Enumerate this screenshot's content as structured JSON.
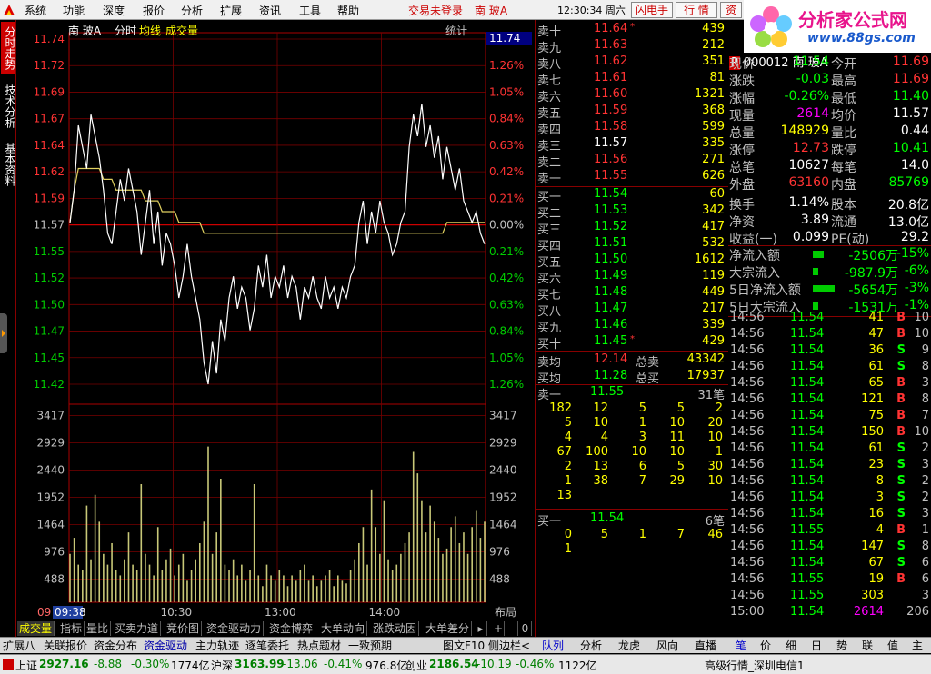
{
  "menubar": {
    "items": [
      "系统",
      "功能",
      "深度",
      "报价",
      "分析",
      "扩展",
      "资讯",
      "工具",
      "帮助"
    ],
    "trade_status": "交易未登录",
    "stock_short": "南  玻A",
    "clock": "12:30:34 周六",
    "btn_flash": "闪电手",
    "btn_quote": "行  情",
    "btn_news": "资"
  },
  "brand": {
    "title": "分析家公式网",
    "url": "www.88gs.com"
  },
  "left_tabs": [
    "分时走势",
    "技术分析",
    "基本资料"
  ],
  "chart_header": {
    "stock": "南  玻A",
    "mode": "分时",
    "avg_label": "均线",
    "vol_label": "成交量",
    "stats_btn": "统计",
    "last_price_badge": "11.74"
  },
  "chart_data": {
    "type": "line",
    "price_axis_left": [
      "11.74",
      "11.72",
      "11.69",
      "11.67",
      "11.64",
      "11.62",
      "11.59",
      "11.57",
      "11.55",
      "11.52",
      "11.50",
      "11.47",
      "11.45",
      "11.42"
    ],
    "pct_axis_right": [
      "",
      "1.26%",
      "1.05%",
      "0.84%",
      "0.63%",
      "0.42%",
      "0.21%",
      "0.00%",
      "0.21%",
      "0.42%",
      "0.63%",
      "0.84%",
      "1.05%",
      "1.26%"
    ],
    "vol_axis_left": [
      "3417",
      "2929",
      "2440",
      "1952",
      "1464",
      "976",
      "488"
    ],
    "vol_axis_right": [
      "3417",
      "2929",
      "2440",
      "1952",
      "1464",
      "976",
      "488"
    ],
    "time_labels": [
      "09:38",
      "10:30",
      "13:00",
      "14:00"
    ],
    "time_start_label": "09",
    "layout_btn": "布局",
    "prev_close": 11.57,
    "ylim": [
      11.42,
      11.74
    ],
    "vol_max": 3417,
    "price": [
      11.57,
      11.6,
      11.66,
      11.64,
      11.62,
      11.67,
      11.65,
      11.63,
      11.6,
      11.56,
      11.55,
      11.58,
      11.61,
      11.59,
      11.62,
      11.6,
      11.58,
      11.54,
      11.57,
      11.6,
      11.55,
      11.58,
      11.53,
      11.56,
      11.55,
      11.53,
      11.5,
      11.52,
      11.55,
      11.52,
      11.5,
      11.48,
      11.44,
      11.42,
      11.46,
      11.43,
      11.48,
      11.46,
      11.5,
      11.52,
      11.49,
      11.51,
      11.5,
      11.47,
      11.49,
      11.53,
      11.51,
      11.54,
      11.5,
      11.52,
      11.51,
      11.53,
      11.5,
      11.52,
      11.51,
      11.48,
      11.51,
      11.5,
      11.52,
      11.5,
      11.49,
      11.52,
      11.5,
      11.51,
      11.49,
      11.51,
      11.5,
      11.52,
      11.53,
      11.57,
      11.59,
      11.55,
      11.58,
      11.56,
      11.59,
      11.57,
      11.56,
      11.54,
      11.55,
      11.57,
      11.58,
      11.64,
      11.67,
      11.65,
      11.68,
      11.64,
      11.66,
      11.63,
      11.65,
      11.61,
      11.64,
      11.62,
      11.6,
      11.62,
      11.59,
      11.58,
      11.57,
      11.58,
      11.56,
      11.55
    ],
    "avg": [
      11.57,
      11.6,
      11.62,
      11.62,
      11.62,
      11.62,
      11.62,
      11.62,
      11.61,
      11.61,
      11.61,
      11.6,
      11.6,
      11.6,
      11.6,
      11.6,
      11.6,
      11.6,
      11.59,
      11.59,
      11.59,
      11.59,
      11.58,
      11.58,
      11.58,
      11.58,
      11.57,
      11.57,
      11.57,
      11.57,
      11.57,
      11.57,
      11.56,
      11.56,
      11.56,
      11.56,
      11.56,
      11.56,
      11.56,
      11.56,
      11.56,
      11.56,
      11.56,
      11.56,
      11.56,
      11.56,
      11.56,
      11.56,
      11.56,
      11.56,
      11.56,
      11.56,
      11.56,
      11.56,
      11.56,
      11.56,
      11.56,
      11.56,
      11.56,
      11.56,
      11.56,
      11.56,
      11.56,
      11.56,
      11.56,
      11.56,
      11.56,
      11.56,
      11.56,
      11.56,
      11.56,
      11.56,
      11.56,
      11.56,
      11.56,
      11.56,
      11.56,
      11.56,
      11.56,
      11.56,
      11.56,
      11.56,
      11.56,
      11.56,
      11.56,
      11.56,
      11.56,
      11.56,
      11.56,
      11.56,
      11.57,
      11.57,
      11.57,
      11.57,
      11.57,
      11.57,
      11.57,
      11.57,
      11.57,
      11.57
    ],
    "volume": [
      900,
      1200,
      700,
      600,
      1800,
      800,
      2000,
      1500,
      900,
      700,
      1100,
      600,
      500,
      800,
      1300,
      700,
      600,
      2200,
      900,
      700,
      500,
      1400,
      600,
      800,
      1000,
      500,
      700,
      900,
      400,
      600,
      800,
      1100,
      1500,
      2900,
      900,
      1300,
      2300,
      700,
      600,
      800,
      500,
      700,
      400,
      600,
      2200,
      500,
      300,
      700,
      500,
      400,
      600,
      500,
      300,
      500,
      400,
      600,
      700,
      400,
      500,
      300,
      400,
      500,
      600,
      300,
      500,
      400,
      350,
      600,
      800,
      1100,
      1400,
      700,
      2100,
      1400,
      900,
      1900,
      800,
      600,
      700,
      900,
      1100,
      1300,
      2800,
      2400,
      1900,
      1300,
      1800,
      1500,
      1200,
      900,
      1000,
      1400,
      1600,
      1100,
      1300,
      900,
      1400,
      1700,
      1200,
      1500
    ]
  },
  "orderbook": {
    "asks": [
      {
        "label": "卖十",
        "price": "11.64",
        "vol": "439",
        "mark": "*"
      },
      {
        "label": "卖九",
        "price": "11.63",
        "vol": "212"
      },
      {
        "label": "卖八",
        "price": "11.62",
        "vol": "351"
      },
      {
        "label": "卖七",
        "price": "11.61",
        "vol": "81"
      },
      {
        "label": "卖六",
        "price": "11.60",
        "vol": "1321"
      },
      {
        "label": "卖五",
        "price": "11.59",
        "vol": "368"
      },
      {
        "label": "卖四",
        "price": "11.58",
        "vol": "599"
      },
      {
        "label": "卖三",
        "price": "11.57",
        "vol": "335"
      },
      {
        "label": "卖二",
        "price": "11.56",
        "vol": "271"
      },
      {
        "label": "卖一",
        "price": "11.55",
        "vol": "626"
      }
    ],
    "bids": [
      {
        "label": "买一",
        "price": "11.54",
        "vol": "60"
      },
      {
        "label": "买二",
        "price": "11.53",
        "vol": "342"
      },
      {
        "label": "买三",
        "price": "11.52",
        "vol": "417"
      },
      {
        "label": "买四",
        "price": "11.51",
        "vol": "532"
      },
      {
        "label": "买五",
        "price": "11.50",
        "vol": "1612"
      },
      {
        "label": "买六",
        "price": "11.49",
        "vol": "119"
      },
      {
        "label": "买七",
        "price": "11.48",
        "vol": "449"
      },
      {
        "label": "买八",
        "price": "11.47",
        "vol": "217"
      },
      {
        "label": "买九",
        "price": "11.46",
        "vol": "339"
      },
      {
        "label": "买十",
        "price": "11.45",
        "vol": "429",
        "mark": "*"
      }
    ],
    "ask_avg_label": "卖均",
    "ask_avg": "12.14",
    "ask_total_label": "总卖",
    "ask_total": "43342",
    "bid_avg_label": "买均",
    "bid_avg": "11.28",
    "bid_total_label": "总买",
    "bid_total": "17937",
    "sell1_queue_label": "卖一",
    "sell1_queue_price": "11.55",
    "sell1_queue_count": "31笔",
    "sell1_queue": [
      [
        "182",
        "12",
        "5",
        "5",
        "2"
      ],
      [
        "5",
        "10",
        "1",
        "10",
        "20"
      ],
      [
        "4",
        "4",
        "3",
        "11",
        "10"
      ],
      [
        "67",
        "100",
        "10",
        "10",
        "1"
      ],
      [
        "2",
        "13",
        "6",
        "5",
        "30"
      ],
      [
        "1",
        "38",
        "7",
        "29",
        "10"
      ],
      [
        "13",
        "",
        "",
        "",
        ""
      ]
    ],
    "buy1_queue_label": "买一",
    "buy1_queue_price": "11.54",
    "buy1_queue_count": "6笔",
    "buy1_queue": [
      [
        "0",
        "5",
        "1",
        "7",
        "46"
      ],
      [
        "1",
        "",
        "",
        "",
        ""
      ]
    ]
  },
  "stats": {
    "code_label": "P",
    "code": "000012 南  玻A",
    "rows": [
      {
        "l1": "现价",
        "v1": "11.54",
        "c1": "#00ff00",
        "l2": "今开",
        "v2": "11.69",
        "c2": "#ff3333"
      },
      {
        "l1": "涨跌",
        "v1": "-0.03",
        "c1": "#00ff00",
        "l2": "最高",
        "v2": "11.69",
        "c2": "#ff3333"
      },
      {
        "l1": "涨幅",
        "v1": "-0.26%",
        "c1": "#00ff00",
        "l2": "最低",
        "v2": "11.40",
        "c2": "#00ff00"
      },
      {
        "l1": "现量",
        "v1": "2614",
        "c1": "#ff00ff",
        "l2": "均价",
        "v2": "11.57",
        "c2": "#ffffff"
      },
      {
        "l1": "总量",
        "v1": "148929",
        "c1": "#ffff00",
        "l2": "量比",
        "v2": "0.44",
        "c2": "#ffffff"
      },
      {
        "l1": "涨停",
        "v1": "12.73",
        "c1": "#ff3333",
        "l2": "跌停",
        "v2": "10.41",
        "c2": "#00ff00"
      },
      {
        "l1": "总笔",
        "v1": "10627",
        "c1": "#ffffff",
        "l2": "每笔",
        "v2": "14.0",
        "c2": "#ffffff"
      },
      {
        "l1": "外盘",
        "v1": "63160",
        "c1": "#ff3333",
        "l2": "内盘",
        "v2": "85769",
        "c2": "#00ff00"
      },
      {
        "l1": "换手",
        "v1": "1.14%",
        "c1": "#ffffff",
        "l2": "股本",
        "v2": "20.8亿",
        "c2": "#ffffff"
      },
      {
        "l1": "净资",
        "v1": "3.89",
        "c1": "#ffffff",
        "l2": "流通",
        "v2": "13.0亿",
        "c2": "#ffffff"
      },
      {
        "l1": "收益(一)",
        "v1": "0.099",
        "c1": "#ffffff",
        "l2": "PE(动)",
        "v2": "29.2",
        "c2": "#ffffff"
      }
    ],
    "flows": [
      {
        "label": "净流入额",
        "value": "-2506万",
        "pct": "-15%",
        "bar": 0.15
      },
      {
        "label": "大宗流入",
        "value": "-987.9万",
        "pct": "-6%",
        "bar": 0.06
      },
      {
        "label": "5日净流入额",
        "value": "-5654万",
        "pct": "-3%",
        "bar": 0.3
      },
      {
        "label": "5日大宗流入",
        "value": "-1531万",
        "pct": "-1%",
        "bar": 0.05
      }
    ]
  },
  "ticks": [
    {
      "t": "14:56",
      "p": "11.54",
      "v": "41",
      "bs": "B",
      "n": "10"
    },
    {
      "t": "14:56",
      "p": "11.54",
      "v": "47",
      "bs": "B",
      "n": "10"
    },
    {
      "t": "14:56",
      "p": "11.54",
      "v": "36",
      "bs": "S",
      "n": "9"
    },
    {
      "t": "14:56",
      "p": "11.54",
      "v": "61",
      "bs": "S",
      "n": "8"
    },
    {
      "t": "14:56",
      "p": "11.54",
      "v": "65",
      "bs": "B",
      "n": "3"
    },
    {
      "t": "14:56",
      "p": "11.54",
      "v": "121",
      "bs": "B",
      "n": "8"
    },
    {
      "t": "14:56",
      "p": "11.54",
      "v": "75",
      "bs": "B",
      "n": "7"
    },
    {
      "t": "14:56",
      "p": "11.54",
      "v": "150",
      "bs": "B",
      "n": "10"
    },
    {
      "t": "14:56",
      "p": "11.54",
      "v": "61",
      "bs": "S",
      "n": "2"
    },
    {
      "t": "14:56",
      "p": "11.54",
      "v": "23",
      "bs": "S",
      "n": "3"
    },
    {
      "t": "14:56",
      "p": "11.54",
      "v": "8",
      "bs": "S",
      "n": "2"
    },
    {
      "t": "14:56",
      "p": "11.54",
      "v": "3",
      "bs": "S",
      "n": "2"
    },
    {
      "t": "14:56",
      "p": "11.54",
      "v": "16",
      "bs": "S",
      "n": "3"
    },
    {
      "t": "14:56",
      "p": "11.55",
      "v": "4",
      "bs": "B",
      "n": "1"
    },
    {
      "t": "14:56",
      "p": "11.54",
      "v": "147",
      "bs": "S",
      "n": "8"
    },
    {
      "t": "14:56",
      "p": "11.54",
      "v": "67",
      "bs": "S",
      "n": "6"
    },
    {
      "t": "14:56",
      "p": "11.55",
      "v": "19",
      "bs": "B",
      "n": "6"
    },
    {
      "t": "14:56",
      "p": "11.55",
      "v": "303",
      "bs": "",
      "n": "3"
    },
    {
      "t": "15:00",
      "p": "11.54",
      "v": "2614",
      "bs": "",
      "n": "206"
    }
  ],
  "bottom_tabs": [
    "成交量",
    "指标",
    "量比",
    "买卖力道",
    "竞价图",
    "资金驱动力",
    "资金博弈",
    "大单动向",
    "涨跌动因",
    "大单差分"
  ],
  "bottom_ctrl": [
    "▸",
    "+",
    "-",
    "0"
  ],
  "toolbar2": [
    "扩展八",
    "关联报价",
    "资金分布",
    "资金驱动",
    "主力轨迹",
    "逐笔委托",
    "热点题材",
    "一致预期",
    "图文F10",
    "侧边栏<"
  ],
  "right_tabs_top": [
    "队列",
    "分析",
    "龙虎",
    "风向",
    "直播"
  ],
  "right_tabs_bottom": [
    "笔",
    "价",
    "细",
    "日",
    "势",
    "联",
    "值",
    "主"
  ],
  "statusbar": {
    "sh_label": "上证",
    "sh_val": "2927.16",
    "sh_chg": "-8.88",
    "sh_pct": "-0.30%",
    "sh_amt": "1774亿",
    "hs_label": "沪深",
    "hs_val": "3163.99",
    "hs_chg": "-13.06",
    "hs_pct": "-0.41%",
    "hs_amt": "976.8亿",
    "cy_label": "创业",
    "cy_val": "2186.54",
    "cy_chg": "-10.19",
    "cy_pct": "-0.46%",
    "cy_amt": "1122亿",
    "feed": "高级行情_深圳电信1"
  }
}
